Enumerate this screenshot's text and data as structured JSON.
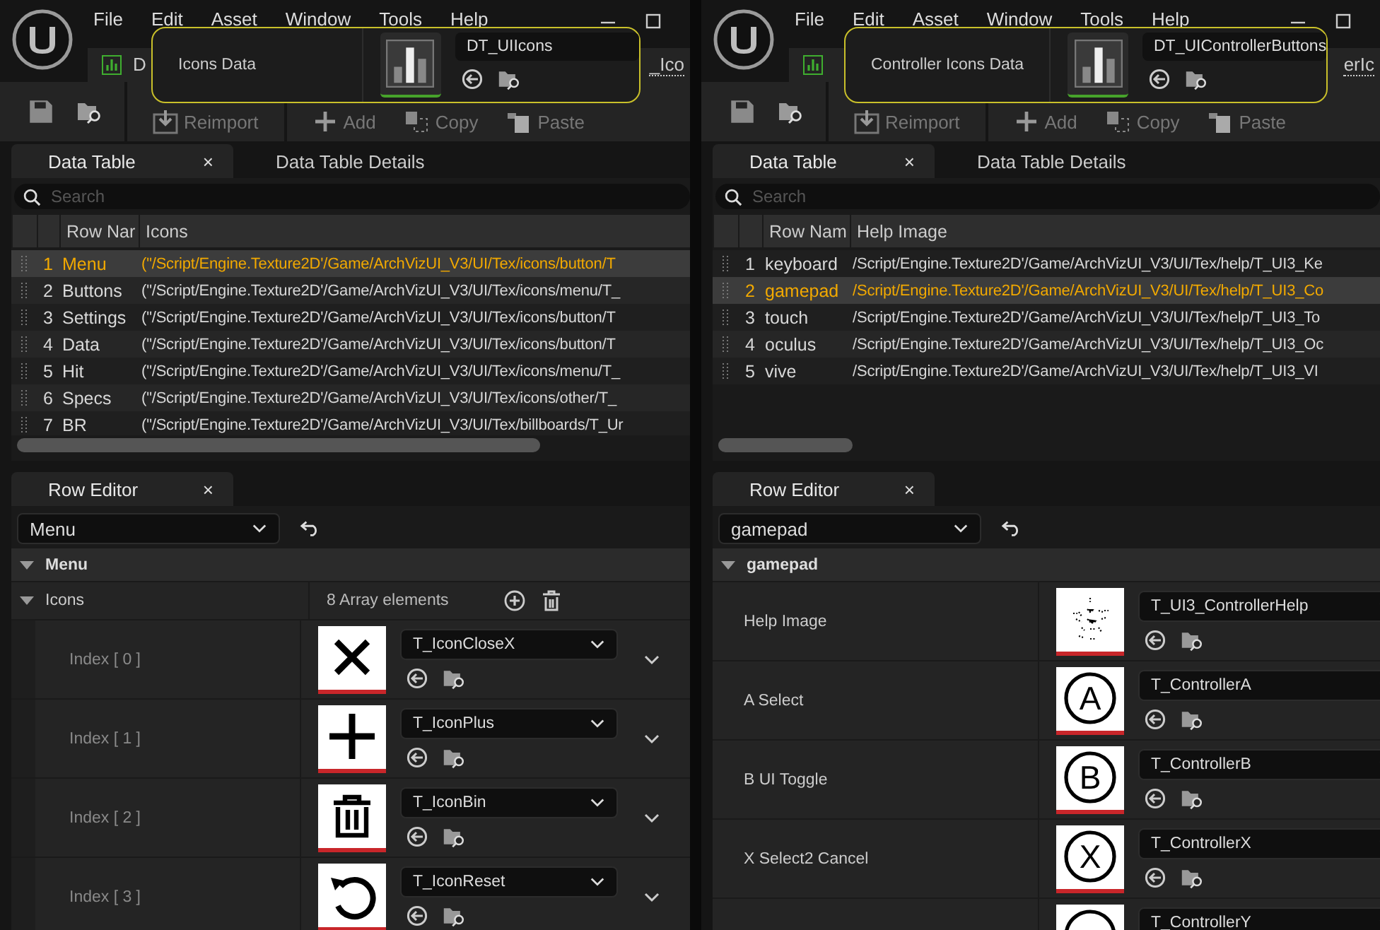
{
  "panels": [
    {
      "menu": [
        "File",
        "Edit",
        "Asset",
        "Window",
        "Tools",
        "Help"
      ],
      "asset_tab": {
        "fragments": [
          "D",
          "_Ico"
        ]
      },
      "toolbar": [
        "Reimport",
        "Add",
        "Copy",
        "Paste"
      ],
      "tooltip": {
        "label": "Icons Data",
        "asset_name": "DT_UIIcons"
      },
      "tabs": [
        {
          "label": "Data Table",
          "close": "×",
          "selected": true
        },
        {
          "label": "Data Table Details",
          "selected": false
        }
      ],
      "search": {
        "placeholder": "Search"
      },
      "table": {
        "columns": [
          "Row Nar",
          "Icons"
        ],
        "rows": [
          {
            "index": "1",
            "name": "Menu",
            "value": "(\"/Script/Engine.Texture2D'/Game/ArchVizUI_V3/UI/Tex/icons/button/T",
            "selected": true
          },
          {
            "index": "2",
            "name": "Buttons",
            "value": "(\"/Script/Engine.Texture2D'/Game/ArchVizUI_V3/UI/Tex/icons/menu/T_",
            "selected": false
          },
          {
            "index": "3",
            "name": "Settings",
            "value": "(\"/Script/Engine.Texture2D'/Game/ArchVizUI_V3/UI/Tex/icons/button/T",
            "selected": false
          },
          {
            "index": "4",
            "name": "Data",
            "value": "(\"/Script/Engine.Texture2D'/Game/ArchVizUI_V3/UI/Tex/icons/button/T",
            "selected": false
          },
          {
            "index": "5",
            "name": "Hit",
            "value": "(\"/Script/Engine.Texture2D'/Game/ArchVizUI_V3/UI/Tex/icons/menu/T_",
            "selected": false
          },
          {
            "index": "6",
            "name": "Specs",
            "value": "(\"/Script/Engine.Texture2D'/Game/ArchVizUI_V3/UI/Tex/icons/other/T_",
            "selected": false
          },
          {
            "index": "7",
            "name": "BR",
            "value": "(\"/Script/Engine.Texture2D'/Game/ArchVizUI_V3/UI/Tex/billboards/T_Ur",
            "selected": false
          }
        ]
      },
      "row_editor": {
        "tab": {
          "label": "Row Editor",
          "close": "×"
        },
        "row": "Menu",
        "section": {
          "label": "Menu",
          "expanded": true
        },
        "properties": [
          {
            "kind": "array",
            "label": "Icons",
            "count": "8 Array elements",
            "expanded": true,
            "children": [
              {
                "kind": "cross",
                "label": "Index [ 0 ]",
                "asset": "T_IconCloseX"
              },
              {
                "kind": "plus",
                "label": "Index [ 1 ]",
                "asset": "T_IconPlus"
              },
              {
                "kind": "bin",
                "label": "Index [ 2 ]",
                "asset": "T_IconBin"
              },
              {
                "kind": "reset",
                "label": "Index [ 3 ]",
                "asset": "T_IconReset"
              }
            ]
          }
        ]
      }
    },
    {
      "menu": [
        "File",
        "Edit",
        "Asset",
        "Window",
        "Tools",
        "Help"
      ],
      "asset_tab": {
        "fragments": [
          "erIc"
        ]
      },
      "toolbar": [
        "Reimport",
        "Add",
        "Copy",
        "Paste"
      ],
      "tooltip": {
        "label": "Controller Icons Data",
        "asset_name": "DT_UIControllerButtons"
      },
      "tabs": [
        {
          "label": "Data Table",
          "close": "×",
          "selected": true
        },
        {
          "label": "Data Table Details",
          "selected": false
        }
      ],
      "search": {
        "placeholder": "Search"
      },
      "table": {
        "columns": [
          "Row Nam",
          "Help Image"
        ],
        "rows": [
          {
            "index": "1",
            "name": "keyboard",
            "value": "/Script/Engine.Texture2D'/Game/ArchVizUI_V3/UI/Tex/help/T_UI3_Ke",
            "selected": false
          },
          {
            "index": "2",
            "name": "gamepad",
            "value": "/Script/Engine.Texture2D'/Game/ArchVizUI_V3/UI/Tex/help/T_UI3_Co",
            "selected": true
          },
          {
            "index": "3",
            "name": "touch",
            "value": "/Script/Engine.Texture2D'/Game/ArchVizUI_V3/UI/Tex/help/T_UI3_To",
            "selected": false
          },
          {
            "index": "4",
            "name": "oculus",
            "value": "/Script/Engine.Texture2D'/Game/ArchVizUI_V3/UI/Tex/help/T_UI3_Oc",
            "selected": false
          },
          {
            "index": "5",
            "name": "vive",
            "value": "/Script/Engine.Texture2D'/Game/ArchVizUI_V3/UI/Tex/help/T_UI3_VI",
            "selected": false
          }
        ]
      },
      "row_editor": {
        "tab": {
          "label": "Row Editor",
          "close": "×"
        },
        "row": "gamepad",
        "section": {
          "label": "gamepad",
          "expanded": true
        },
        "properties": [
          {
            "kind": "sketch",
            "label": "Help Image",
            "asset": "T_UI3_ControllerHelp"
          },
          {
            "kind": "letter",
            "glyph": "A",
            "label": "A Select",
            "asset": "T_ControllerA"
          },
          {
            "kind": "letter",
            "glyph": "B",
            "label": "B UI Toggle",
            "asset": "T_ControllerB"
          },
          {
            "kind": "letter",
            "glyph": "X",
            "label": "X Select2 Cancel",
            "asset": "T_ControllerX"
          },
          {
            "kind": "letter",
            "asset": "T_ControllerY"
          }
        ]
      }
    }
  ]
}
